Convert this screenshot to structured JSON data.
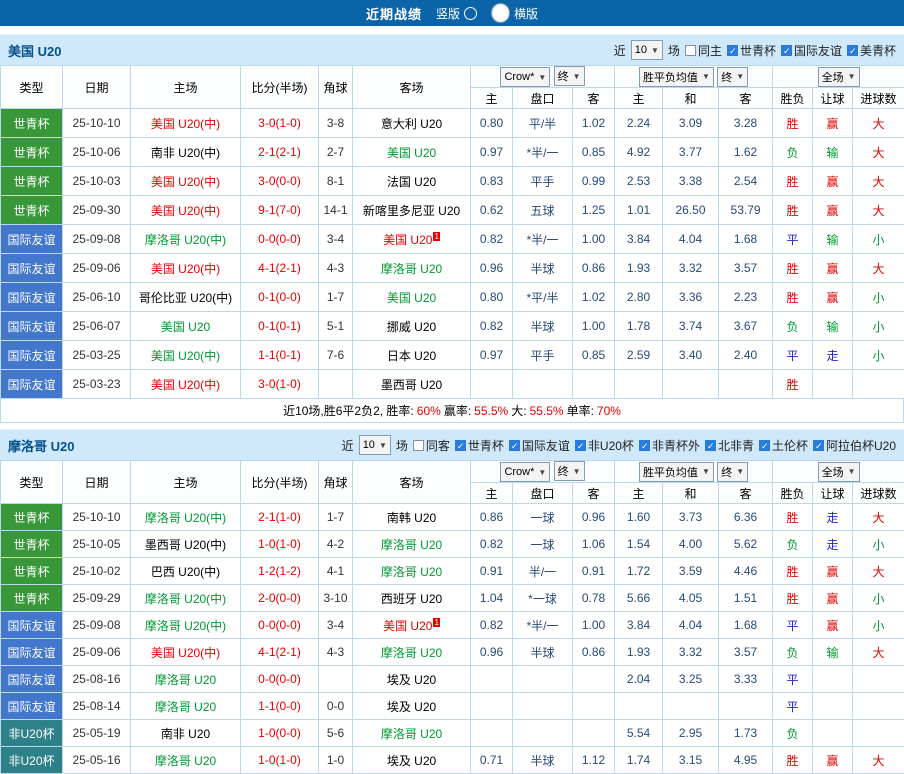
{
  "topbar": {
    "title": "近期战绩",
    "vertical_label": "竖版",
    "horizontal_label": "横版",
    "selected": "横版"
  },
  "colors": {
    "topbar_bg": "#0b63a8",
    "section_bg": "#cfe8fa",
    "worldcup_bg": "#389738",
    "friendly_bg": "#4377cc",
    "africacup_bg": "#2e8089",
    "win": "#e60000",
    "lose": "#009933",
    "draw": "#2222cc"
  },
  "table_header": {
    "static_cols": [
      "类型",
      "日期",
      "主场",
      "比分(半场)",
      "角球",
      "客场"
    ],
    "dropdowns": {
      "crown": "Crow*",
      "final1": "终",
      "avg": "胜平负均值",
      "final2": "终",
      "fullmatch": "全场"
    },
    "sub_cols": [
      "主",
      "盘口",
      "客",
      "主",
      "和",
      "客",
      "胜负",
      "让球",
      "进球数"
    ]
  },
  "sections": [
    {
      "team": "美国 U20",
      "filter": {
        "prefix": "近",
        "count": "10",
        "suffix": "场",
        "checkboxes": [
          {
            "label": "同主",
            "checked": false
          },
          {
            "label": "世青杯",
            "checked": true
          },
          {
            "label": "国际友谊",
            "checked": true
          },
          {
            "label": "美青杯",
            "checked": true
          }
        ]
      },
      "rows": [
        {
          "type": "世青杯",
          "tc": "wc",
          "date": "25-10-10",
          "home": "美国 U20(中)",
          "hcol": "red",
          "score": "3-0(1-0)",
          "corners": "3-8",
          "away": "意大利 U20",
          "acol": "black",
          "sup": "",
          "o1": "0.80",
          "hcap": "平/半",
          "o2": "1.02",
          "a1": "2.24",
          "a2": "3.09",
          "a3": "3.28",
          "r1": "胜",
          "r1c": "red",
          "r2": "赢",
          "r2c": "red",
          "r3": "大",
          "r3c": "red"
        },
        {
          "type": "世青杯",
          "tc": "wc",
          "date": "25-10-06",
          "home": "南非 U20(中)",
          "hcol": "black",
          "score": "2-1(2-1)",
          "corners": "2-7",
          "away": "美国 U20",
          "acol": "green",
          "sup": "",
          "o1": "0.97",
          "hcap": "*半/一",
          "o2": "0.85",
          "a1": "4.92",
          "a2": "3.77",
          "a3": "1.62",
          "r1": "负",
          "r1c": "green",
          "r2": "输",
          "r2c": "green",
          "r3": "大",
          "r3c": "red"
        },
        {
          "type": "世青杯",
          "tc": "wc",
          "date": "25-10-03",
          "home": "美国 U20(中)",
          "hcol": "red",
          "score": "3-0(0-0)",
          "corners": "8-1",
          "away": "法国 U20",
          "acol": "black",
          "sup": "",
          "o1": "0.83",
          "hcap": "平手",
          "o2": "0.99",
          "a1": "2.53",
          "a2": "3.38",
          "a3": "2.54",
          "r1": "胜",
          "r1c": "red",
          "r2": "赢",
          "r2c": "red",
          "r3": "大",
          "r3c": "red"
        },
        {
          "type": "世青杯",
          "tc": "wc",
          "date": "25-09-30",
          "home": "美国 U20(中)",
          "hcol": "red",
          "score": "9-1(7-0)",
          "corners": "14-1",
          "away": "新喀里多尼亚 U20",
          "acol": "black",
          "sup": "",
          "o1": "0.62",
          "hcap": "五球",
          "o2": "1.25",
          "a1": "1.01",
          "a2": "26.50",
          "a3": "53.79",
          "r1": "胜",
          "r1c": "red",
          "r2": "赢",
          "r2c": "red",
          "r3": "大",
          "r3c": "red"
        },
        {
          "type": "国际友谊",
          "tc": "fr",
          "date": "25-09-08",
          "home": "摩洛哥 U20(中)",
          "hcol": "green",
          "score": "0-0(0-0)",
          "corners": "3-4",
          "away": "美国 U20",
          "acol": "red",
          "sup": "1",
          "o1": "0.82",
          "hcap": "*半/一",
          "o2": "1.00",
          "a1": "3.84",
          "a2": "4.04",
          "a3": "1.68",
          "r1": "平",
          "r1c": "blue",
          "r2": "输",
          "r2c": "green",
          "r3": "小",
          "r3c": "green"
        },
        {
          "type": "国际友谊",
          "tc": "fr",
          "date": "25-09-06",
          "home": "美国 U20(中)",
          "hcol": "red",
          "score": "4-1(2-1)",
          "corners": "4-3",
          "away": "摩洛哥 U20",
          "acol": "green",
          "sup": "",
          "o1": "0.96",
          "hcap": "半球",
          "o2": "0.86",
          "a1": "1.93",
          "a2": "3.32",
          "a3": "3.57",
          "r1": "胜",
          "r1c": "red",
          "r2": "赢",
          "r2c": "red",
          "r3": "大",
          "r3c": "red"
        },
        {
          "type": "国际友谊",
          "tc": "fr",
          "date": "25-06-10",
          "home": "哥伦比亚 U20(中)",
          "hcol": "black",
          "score": "0-1(0-0)",
          "corners": "1-7",
          "away": "美国 U20",
          "acol": "green",
          "sup": "",
          "o1": "0.80",
          "hcap": "*平/半",
          "o2": "1.02",
          "a1": "2.80",
          "a2": "3.36",
          "a3": "2.23",
          "r1": "胜",
          "r1c": "red",
          "r2": "赢",
          "r2c": "red",
          "r3": "小",
          "r3c": "green"
        },
        {
          "type": "国际友谊",
          "tc": "fr",
          "date": "25-06-07",
          "home": "美国 U20",
          "hcol": "green",
          "score": "0-1(0-1)",
          "corners": "5-1",
          "away": "挪威 U20",
          "acol": "black",
          "sup": "",
          "o1": "0.82",
          "hcap": "半球",
          "o2": "1.00",
          "a1": "1.78",
          "a2": "3.74",
          "a3": "3.67",
          "r1": "负",
          "r1c": "green",
          "r2": "输",
          "r2c": "green",
          "r3": "小",
          "r3c": "green"
        },
        {
          "type": "国际友谊",
          "tc": "fr",
          "date": "25-03-25",
          "home": "美国 U20(中)",
          "hcol": "green",
          "score": "1-1(0-1)",
          "corners": "7-6",
          "away": "日本 U20",
          "acol": "black",
          "sup": "",
          "o1": "0.97",
          "hcap": "平手",
          "o2": "0.85",
          "a1": "2.59",
          "a2": "3.40",
          "a3": "2.40",
          "r1": "平",
          "r1c": "blue",
          "r2": "走",
          "r2c": "blue",
          "r3": "小",
          "r3c": "green"
        },
        {
          "type": "国际友谊",
          "tc": "fr",
          "date": "25-03-23",
          "home": "美国 U20(中)",
          "hcol": "red",
          "score": "3-0(1-0)",
          "corners": "",
          "away": "墨西哥 U20",
          "acol": "black",
          "sup": "",
          "o1": "",
          "hcap": "",
          "o2": "",
          "a1": "",
          "a2": "",
          "a3": "",
          "r1": "胜",
          "r1c": "red",
          "r2": "",
          "r2c": "",
          "r3": "",
          "r3c": ""
        }
      ],
      "summary": [
        {
          "text": "近10场,胜6平2负2, 胜率:",
          "color": "black"
        },
        {
          "text": "60%",
          "color": "red"
        },
        {
          "text": "赢率:",
          "color": "black"
        },
        {
          "text": "55.5%",
          "color": "red"
        },
        {
          "text": "大:",
          "color": "black"
        },
        {
          "text": "55.5%",
          "color": "red"
        },
        {
          "text": "单率:",
          "color": "black"
        },
        {
          "text": "70%",
          "color": "red"
        }
      ]
    },
    {
      "team": "摩洛哥 U20",
      "filter": {
        "prefix": "近",
        "count": "10",
        "suffix": "场",
        "checkboxes": [
          {
            "label": "同客",
            "checked": false
          },
          {
            "label": "世青杯",
            "checked": true
          },
          {
            "label": "国际友谊",
            "checked": true
          },
          {
            "label": "非U20杯",
            "checked": true
          },
          {
            "label": "非青杯外",
            "checked": true
          },
          {
            "label": "北非青",
            "checked": true
          },
          {
            "label": "土伦杯",
            "checked": true
          },
          {
            "label": "阿拉伯杯U20",
            "checked": true
          }
        ]
      },
      "rows": [
        {
          "type": "世青杯",
          "tc": "wc",
          "date": "25-10-10",
          "home": "摩洛哥 U20(中)",
          "hcol": "green",
          "score": "2-1(1-0)",
          "corners": "1-7",
          "away": "南韩 U20",
          "acol": "black",
          "sup": "",
          "o1": "0.86",
          "hcap": "一球",
          "o2": "0.96",
          "a1": "1.60",
          "a2": "3.73",
          "a3": "6.36",
          "r1": "胜",
          "r1c": "red",
          "r2": "走",
          "r2c": "blue",
          "r3": "大",
          "r3c": "red"
        },
        {
          "type": "世青杯",
          "tc": "wc",
          "date": "25-10-05",
          "home": "墨西哥 U20(中)",
          "hcol": "black",
          "score": "1-0(1-0)",
          "corners": "4-2",
          "away": "摩洛哥 U20",
          "acol": "green",
          "sup": "",
          "o1": "0.82",
          "hcap": "一球",
          "o2": "1.06",
          "a1": "1.54",
          "a2": "4.00",
          "a3": "5.62",
          "r1": "负",
          "r1c": "green",
          "r2": "走",
          "r2c": "blue",
          "r3": "小",
          "r3c": "green"
        },
        {
          "type": "世青杯",
          "tc": "wc",
          "date": "25-10-02",
          "home": "巴西 U20(中)",
          "hcol": "black",
          "score": "1-2(1-2)",
          "corners": "4-1",
          "away": "摩洛哥 U20",
          "acol": "green",
          "sup": "",
          "o1": "0.91",
          "hcap": "半/一",
          "o2": "0.91",
          "a1": "1.72",
          "a2": "3.59",
          "a3": "4.46",
          "r1": "胜",
          "r1c": "red",
          "r2": "赢",
          "r2c": "red",
          "r3": "大",
          "r3c": "red"
        },
        {
          "type": "世青杯",
          "tc": "wc",
          "date": "25-09-29",
          "home": "摩洛哥 U20(中)",
          "hcol": "green",
          "score": "2-0(0-0)",
          "corners": "3-10",
          "away": "西班牙 U20",
          "acol": "black",
          "sup": "",
          "o1": "1.04",
          "hcap": "*一球",
          "o2": "0.78",
          "a1": "5.66",
          "a2": "4.05",
          "a3": "1.51",
          "r1": "胜",
          "r1c": "red",
          "r2": "赢",
          "r2c": "red",
          "r3": "小",
          "r3c": "green"
        },
        {
          "type": "国际友谊",
          "tc": "fr",
          "date": "25-09-08",
          "home": "摩洛哥 U20(中)",
          "hcol": "green",
          "score": "0-0(0-0)",
          "corners": "3-4",
          "away": "美国 U20",
          "acol": "red",
          "sup": "1",
          "o1": "0.82",
          "hcap": "*半/一",
          "o2": "1.00",
          "a1": "3.84",
          "a2": "4.04",
          "a3": "1.68",
          "r1": "平",
          "r1c": "blue",
          "r2": "赢",
          "r2c": "red",
          "r3": "小",
          "r3c": "green"
        },
        {
          "type": "国际友谊",
          "tc": "fr",
          "date": "25-09-06",
          "home": "美国 U20(中)",
          "hcol": "red",
          "score": "4-1(2-1)",
          "corners": "4-3",
          "away": "摩洛哥 U20",
          "acol": "green",
          "sup": "",
          "o1": "0.96",
          "hcap": "半球",
          "o2": "0.86",
          "a1": "1.93",
          "a2": "3.32",
          "a3": "3.57",
          "r1": "负",
          "r1c": "green",
          "r2": "输",
          "r2c": "green",
          "r3": "大",
          "r3c": "red"
        },
        {
          "type": "国际友谊",
          "tc": "fr",
          "date": "25-08-16",
          "home": "摩洛哥 U20",
          "hcol": "green",
          "score": "0-0(0-0)",
          "corners": "",
          "away": "埃及 U20",
          "acol": "black",
          "sup": "",
          "o1": "",
          "hcap": "",
          "o2": "",
          "a1": "2.04",
          "a2": "3.25",
          "a3": "3.33",
          "r1": "平",
          "r1c": "blue",
          "r2": "",
          "r2c": "",
          "r3": "",
          "r3c": ""
        },
        {
          "type": "国际友谊",
          "tc": "fr",
          "date": "25-08-14",
          "home": "摩洛哥 U20",
          "hcol": "green",
          "score": "1-1(0-0)",
          "corners": "0-0",
          "away": "埃及 U20",
          "acol": "black",
          "sup": "",
          "o1": "",
          "hcap": "",
          "o2": "",
          "a1": "",
          "a2": "",
          "a3": "",
          "r1": "平",
          "r1c": "blue",
          "r2": "",
          "r2c": "",
          "r3": "",
          "r3c": ""
        },
        {
          "type": "非U20杯",
          "tc": "af",
          "date": "25-05-19",
          "home": "南非 U20",
          "hcol": "black",
          "score": "1-0(0-0)",
          "corners": "5-6",
          "away": "摩洛哥 U20",
          "acol": "green",
          "sup": "",
          "o1": "",
          "hcap": "",
          "o2": "",
          "a1": "5.54",
          "a2": "2.95",
          "a3": "1.73",
          "r1": "负",
          "r1c": "green",
          "r2": "",
          "r2c": "",
          "r3": "",
          "r3c": ""
        },
        {
          "type": "非U20杯",
          "tc": "af",
          "date": "25-05-16",
          "home": "摩洛哥 U20",
          "hcol": "green",
          "score": "1-0(1-0)",
          "corners": "1-0",
          "away": "埃及 U20",
          "acol": "black",
          "sup": "",
          "o1": "0.71",
          "hcap": "半球",
          "o2": "1.12",
          "a1": "1.74",
          "a2": "3.15",
          "a3": "4.95",
          "r1": "胜",
          "r1c": "red",
          "r2": "赢",
          "r2c": "red",
          "r3": "大",
          "r3c": "red"
        }
      ],
      "summary": []
    }
  ]
}
